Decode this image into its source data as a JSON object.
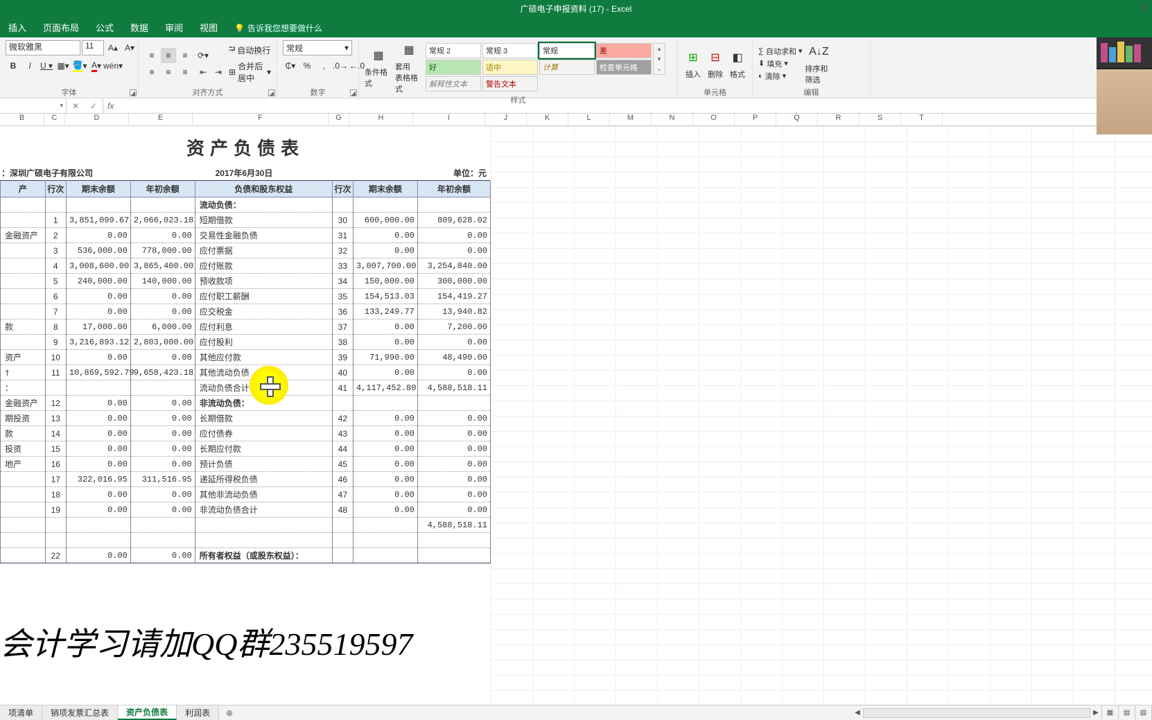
{
  "window": {
    "title": "广硕电子申报资料 (17) - Excel",
    "user_hint": "登"
  },
  "tabs": {
    "insert": "插入",
    "layout": "页面布局",
    "formula": "公式",
    "data": "数据",
    "review": "审阅",
    "view": "视图",
    "tellme": "告诉我您想要做什么"
  },
  "font": {
    "name": "微软雅黑",
    "size": "11",
    "group": "字体"
  },
  "align": {
    "wrap": "自动换行",
    "merge": "合并后居中",
    "group": "对齐方式"
  },
  "number": {
    "fmt": "常规",
    "group": "数字",
    "pct": "%",
    "comma": ",",
    "inc": ".00",
    "dec": ".0"
  },
  "styleBtns": {
    "cond": "条件格式",
    "tbl": "套用\n表格格式",
    "group": "样式"
  },
  "styles": {
    "n2": "常规 2",
    "n3": "常规 3",
    "n": "常规",
    "bad": "差",
    "good": "好",
    "neutral": "适中",
    "calc": "计算",
    "check": "检查单元格",
    "explain": "解释性文本",
    "warn": "警告文本"
  },
  "cells": {
    "ins": "插入",
    "del": "删除",
    "fmt": "格式",
    "group": "单元格"
  },
  "edit": {
    "sum": "自动求和",
    "fill": "填充",
    "clear": "清除",
    "sort": "排序和筛选",
    "group": "编辑"
  },
  "fbar": {
    "name": "",
    "fx": "fx"
  },
  "cols": [
    "B",
    "C",
    "D",
    "E",
    "F",
    "G",
    "H",
    "I",
    "J",
    "K",
    "L",
    "M",
    "N",
    "O",
    "P",
    "Q",
    "R",
    "S",
    "T"
  ],
  "report": {
    "title": "资产负债表",
    "company_lbl": "：深圳广硕电子有限公司",
    "date": "2017年6月30日",
    "unit": "单位：元",
    "hdr": {
      "asset": "产",
      "rn": "行次",
      "endbal": "期末余额",
      "begbal": "年初余额",
      "liab": "负债和股东权益"
    }
  },
  "rows": [
    {
      "a": "",
      "c": "",
      "d": "",
      "e": "",
      "f": "流动负债：",
      "g": "",
      "h": "",
      "i": "",
      "sec_f": true
    },
    {
      "a": "",
      "c": "1",
      "d": "3,851,099.67",
      "e": "2,066,023.18",
      "f": "短期借款",
      "g": "30",
      "h": "600,000.00",
      "i": "809,628.02"
    },
    {
      "a": "金融资产",
      "c": "2",
      "d": "0.00",
      "e": "0.00",
      "f": "交易性金融负债",
      "g": "31",
      "h": "0.00",
      "i": "0.00"
    },
    {
      "a": "",
      "c": "3",
      "d": "536,000.00",
      "e": "778,000.00",
      "f": "应付票据",
      "g": "32",
      "h": "0.00",
      "i": "0.00"
    },
    {
      "a": "",
      "c": "4",
      "d": "3,008,600.00",
      "e": "3,865,400.00",
      "f": "应付账款",
      "g": "33",
      "h": "3,007,700.00",
      "i": "3,254,840.00"
    },
    {
      "a": "",
      "c": "5",
      "d": "240,000.00",
      "e": "140,000.00",
      "f": "预收款项",
      "g": "34",
      "h": "150,000.00",
      "i": "300,000.00"
    },
    {
      "a": "",
      "c": "6",
      "d": "0.00",
      "e": "0.00",
      "f": "应付职工薪酬",
      "g": "35",
      "h": "154,513.03",
      "i": "154,419.27"
    },
    {
      "a": "",
      "c": "7",
      "d": "0.00",
      "e": "0.00",
      "f": "应交税金",
      "g": "36",
      "h": "133,249.77",
      "i": "13,940.82"
    },
    {
      "a": "款",
      "c": "8",
      "d": "17,000.00",
      "e": "6,000.00",
      "f": "应付利息",
      "g": "37",
      "h": "0.00",
      "i": "7,200.00"
    },
    {
      "a": "",
      "c": "9",
      "d": "3,216,893.12",
      "e": "2,803,000.00",
      "f": "应付股利",
      "g": "38",
      "h": "0.00",
      "i": "0.00"
    },
    {
      "a": "资产",
      "c": "10",
      "d": "0.00",
      "e": "0.00",
      "f": "其他应付款",
      "g": "39",
      "h": "71,990.00",
      "i": "48,490.00"
    },
    {
      "a": "†",
      "c": "11",
      "d": "10,869,592.79",
      "e": "9,658,423.18",
      "f": "其他流动负债",
      "g": "40",
      "h": "0.00",
      "i": "0.00"
    },
    {
      "a": "：",
      "c": "",
      "d": "",
      "e": "",
      "f": "流动负债合计",
      "g": "41",
      "h": "4,117,452.80",
      "i": "4,588,518.11"
    },
    {
      "a": "金融资产",
      "c": "12",
      "d": "0.00",
      "e": "0.00",
      "f": "非流动负债：",
      "g": "",
      "h": "",
      "i": "",
      "sec_f": true
    },
    {
      "a": "期投资",
      "c": "13",
      "d": "0.00",
      "e": "0.00",
      "f": "长期借款",
      "g": "42",
      "h": "0.00",
      "i": "0.00"
    },
    {
      "a": "款",
      "c": "14",
      "d": "0.00",
      "e": "0.00",
      "f": "应付债券",
      "g": "43",
      "h": "0.00",
      "i": "0.00"
    },
    {
      "a": "投资",
      "c": "15",
      "d": "0.00",
      "e": "0.00",
      "f": "长期应付款",
      "g": "44",
      "h": "0.00",
      "i": "0.00"
    },
    {
      "a": "地产",
      "c": "16",
      "d": "0.00",
      "e": "0.00",
      "f": "预计负债",
      "g": "45",
      "h": "0.00",
      "i": "0.00"
    },
    {
      "a": "",
      "c": "17",
      "d": "322,016.95",
      "e": "311,516.95",
      "f": "递延所得税负债",
      "g": "46",
      "h": "0.00",
      "i": "0.00"
    },
    {
      "a": "",
      "c": "18",
      "d": "0.00",
      "e": "0.00",
      "f": "其他非流动负债",
      "g": "47",
      "h": "0.00",
      "i": "0.00"
    },
    {
      "a": "",
      "c": "19",
      "d": "0.00",
      "e": "0.00",
      "f": "非流动负债合计",
      "g": "48",
      "h": "0.00",
      "i": "0.00"
    },
    {
      "a": "",
      "c": "",
      "d": "",
      "e": "",
      "f": "",
      "g": "",
      "h": "",
      "i": "4,588,518.11"
    },
    {
      "a": "",
      "c": "",
      "d": "",
      "e": "",
      "f": "",
      "g": "",
      "h": "",
      "i": ""
    },
    {
      "a": "",
      "c": "22",
      "d": "0.00",
      "e": "0.00",
      "f": "所有者权益（或股东权益）：",
      "g": "",
      "h": "",
      "i": "",
      "sec_f": true
    }
  ],
  "watermark": "会计学习请加QQ群235519597",
  "sheets": {
    "s1": "项清单",
    "s2": "销项发票汇总表",
    "s3": "资产负债表",
    "s4": "利润表"
  }
}
